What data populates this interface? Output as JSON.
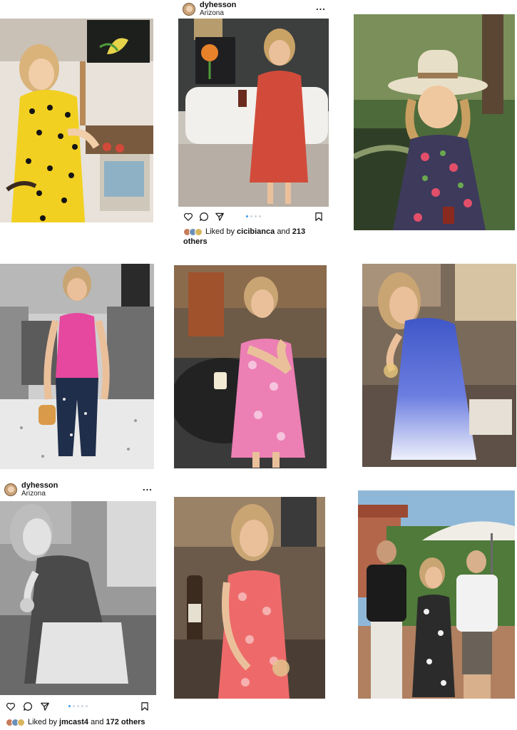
{
  "posts": [
    {
      "username": "dyhesson",
      "location": "Arizona",
      "more_label": "...",
      "liked_by_prefix": "Liked by",
      "liked_by_user": "cicibianca",
      "liked_by_and": "and",
      "liked_by_count": "213",
      "liked_by_suffix": "others",
      "carousel_total": 4,
      "carousel_active": 1
    },
    {
      "username": "dyhesson",
      "location": "Arizona",
      "more_label": "...",
      "liked_by_prefix": "Liked by",
      "liked_by_user": "jmcast4",
      "liked_by_and": "and",
      "liked_by_count": "172 others",
      "carousel_total": 5,
      "carousel_active": 1
    }
  ],
  "icons": [
    "heart-icon",
    "comment-icon",
    "share-icon",
    "bookmark-icon"
  ],
  "photos": [
    {
      "name": "photo-yellow-polka-dress-painting"
    },
    {
      "name": "photo-red-dress-flower-painting"
    },
    {
      "name": "photo-cowboy-hat-floral-jumpsuit"
    },
    {
      "name": "photo-pink-tank-jeans-studio"
    },
    {
      "name": "photo-pink-floral-dress-kitchen"
    },
    {
      "name": "photo-blue-ombre-dress"
    },
    {
      "name": "photo-black-white-dress-post"
    },
    {
      "name": "photo-coral-print-dress-wine"
    },
    {
      "name": "photo-patio-group-umbrella"
    }
  ],
  "colors": {
    "accent_blue": "#3897f0",
    "text": "#111111",
    "dot_inactive": "#cfd6de"
  }
}
